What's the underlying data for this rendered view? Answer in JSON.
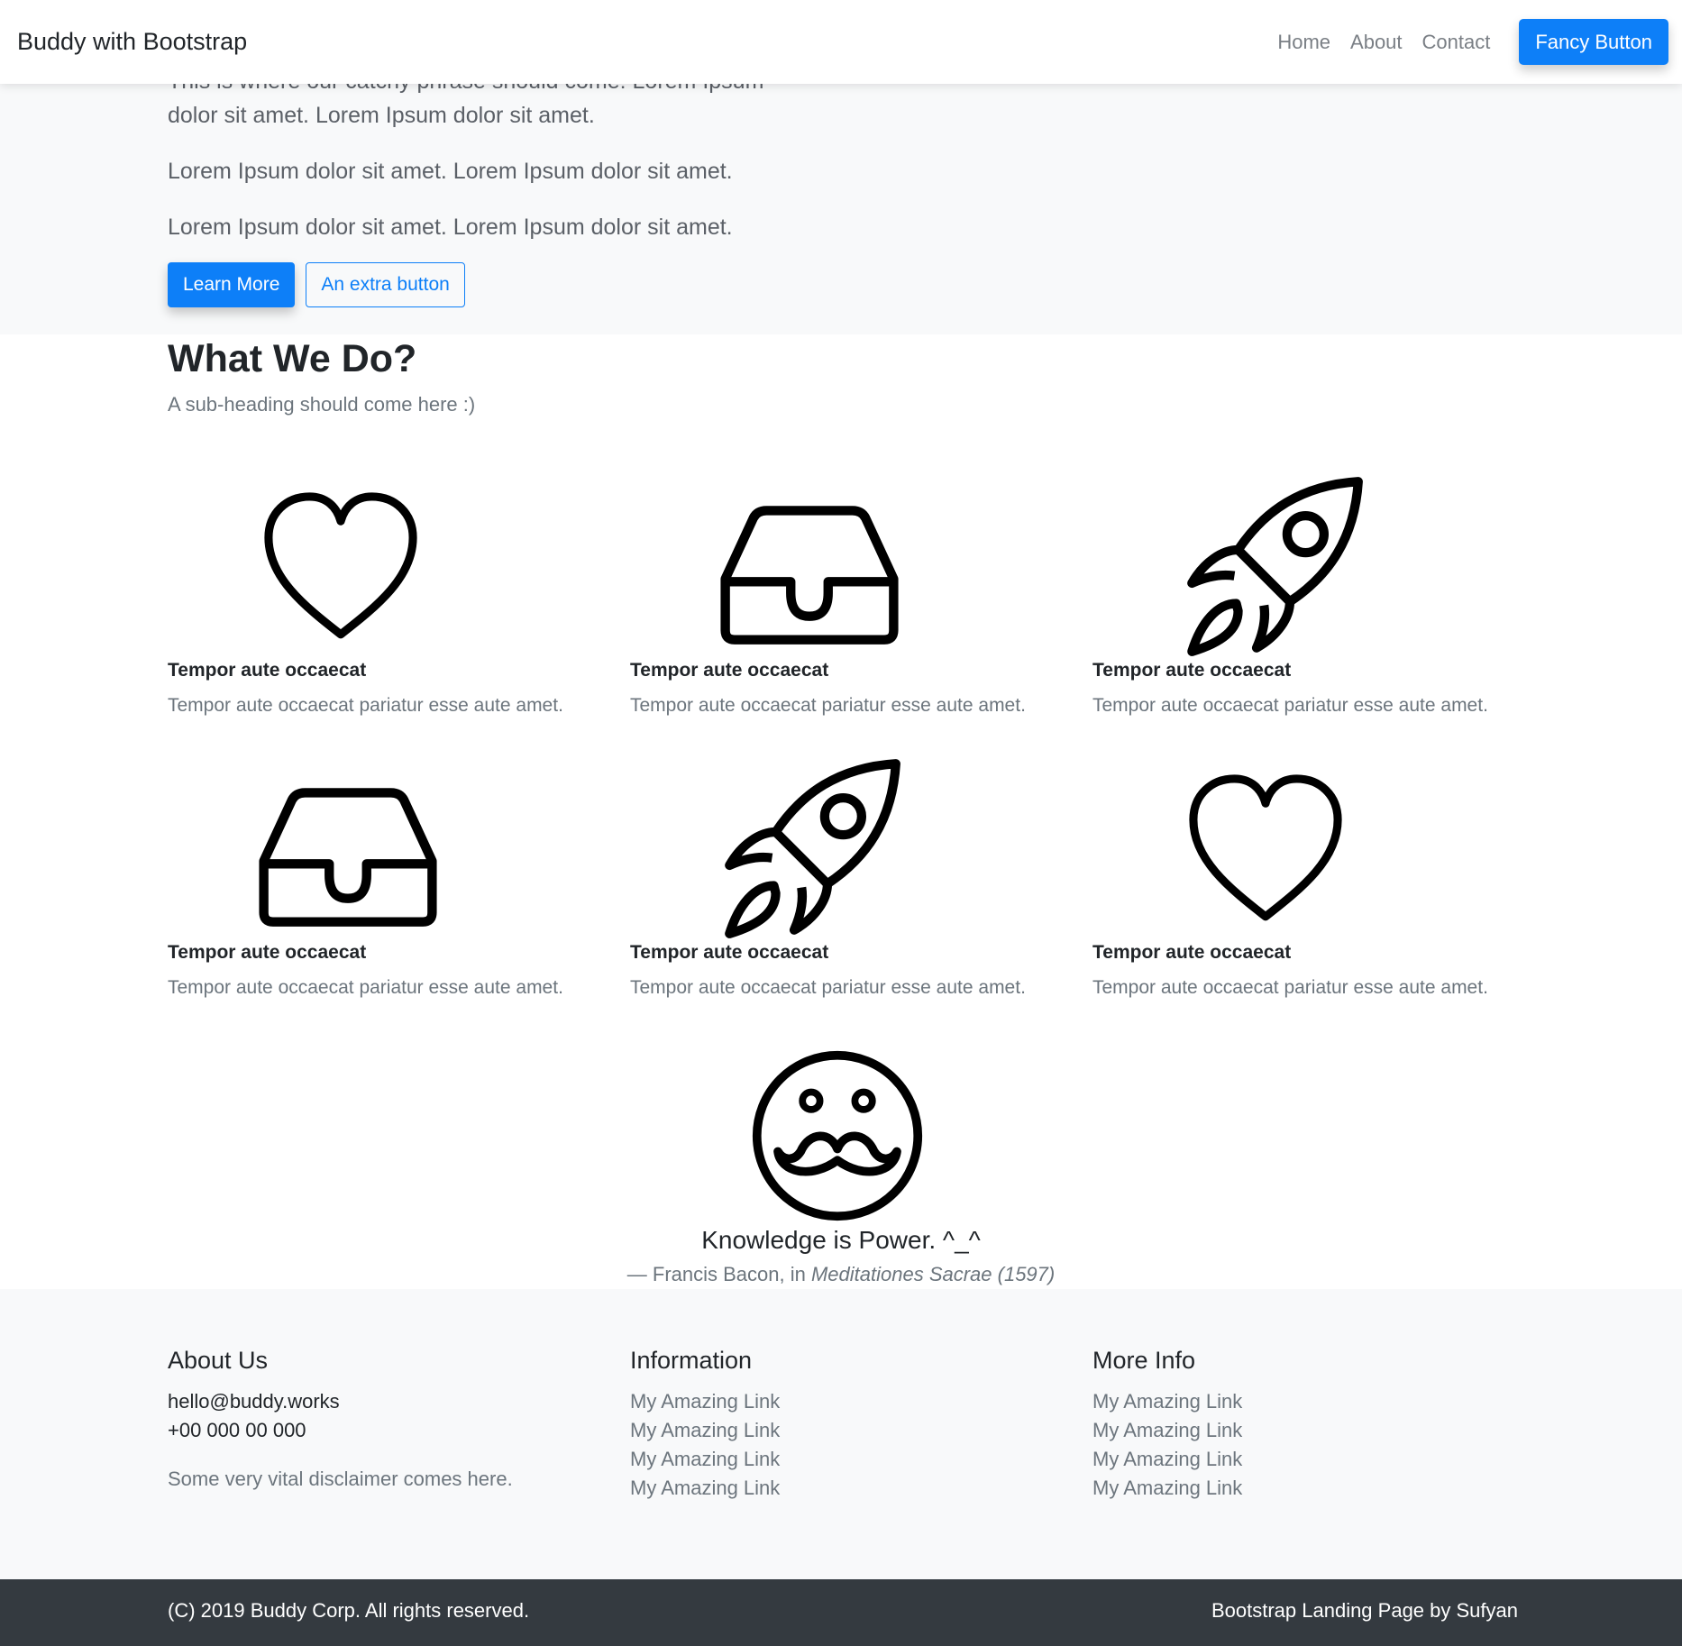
{
  "navbar": {
    "brand": "Buddy with Bootstrap",
    "links": [
      "Home",
      "About",
      "Contact"
    ],
    "cta": "Fancy Button"
  },
  "hero": {
    "paragraphs": [
      "This is where our catchy phrase should come! Lorem Ipsum dolor sit amet. Lorem Ipsum dolor sit amet.",
      "Lorem Ipsum dolor sit amet. Lorem Ipsum dolor sit amet.",
      "Lorem Ipsum dolor sit amet. Lorem Ipsum dolor sit amet."
    ],
    "primary_button": "Learn More",
    "secondary_button": "An extra button"
  },
  "features": {
    "title": "What We Do?",
    "subtitle": "A sub-heading should come here :)",
    "items": [
      {
        "icon": "heart-icon",
        "title": "Tempor aute occaecat",
        "description": "Tempor aute occaecat pariatur esse aute amet."
      },
      {
        "icon": "inbox-icon",
        "title": "Tempor aute occaecat",
        "description": "Tempor aute occaecat pariatur esse aute amet."
      },
      {
        "icon": "rocket-icon",
        "title": "Tempor aute occaecat",
        "description": "Tempor aute occaecat pariatur esse aute amet."
      },
      {
        "icon": "inbox-icon",
        "title": "Tempor aute occaecat",
        "description": "Tempor aute occaecat pariatur esse aute amet."
      },
      {
        "icon": "rocket-icon",
        "title": "Tempor aute occaecat",
        "description": "Tempor aute occaecat pariatur esse aute amet."
      },
      {
        "icon": "heart-icon",
        "title": "Tempor aute occaecat",
        "description": "Tempor aute occaecat pariatur esse aute amet."
      }
    ]
  },
  "quote": {
    "icon": "mustache-face-icon",
    "text": "Knowledge is Power. ^_^",
    "author_prefix": "— Francis Bacon, in",
    "source": "Meditationes Sacrae (1597)"
  },
  "footer": {
    "about": {
      "title": "About Us",
      "email": "hello@buddy.works",
      "phone": "+00 000 00 000",
      "disclaimer": "Some very vital disclaimer comes here."
    },
    "information": {
      "title": "Information",
      "links": [
        "My Amazing Link",
        "My Amazing Link",
        "My Amazing Link",
        "My Amazing Link"
      ]
    },
    "more_info": {
      "title": "More Info",
      "links": [
        "My Amazing Link",
        "My Amazing Link",
        "My Amazing Link",
        "My Amazing Link"
      ]
    },
    "copyright": "(C) 2019 Buddy Corp. All rights reserved.",
    "credit": "Bootstrap Landing Page by Sufyan"
  },
  "colors": {
    "primary": "#0d7ff8",
    "hero_bg": "#f8f9fa",
    "footer_bar": "#343a40",
    "muted": "#6c757d"
  }
}
